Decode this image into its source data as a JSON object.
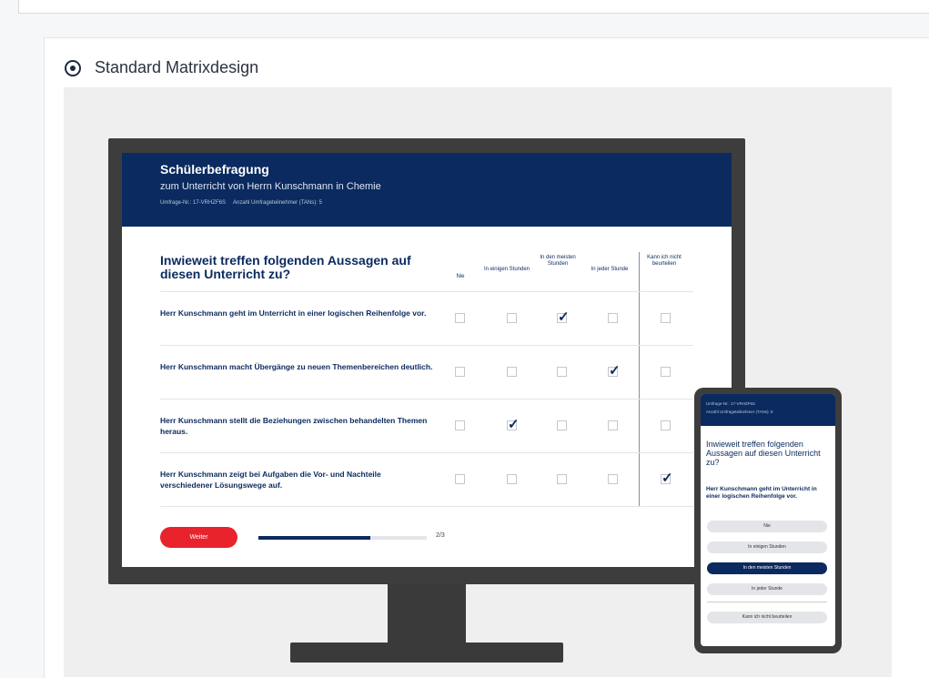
{
  "option": {
    "label": "Standard Matrixdesign",
    "selected": true
  },
  "survey": {
    "title": "Schülerbefragung",
    "subtitle": "zum Unterricht von Herrn Kunschmann in Chemie",
    "meta": [
      "Umfrage-Nr.: 17-VRHZF6S",
      "Anzahl Umfrageteilnehmer (TANs): 5"
    ],
    "question": "Inwieweit treffen folgenden Aussagen auf diesen Unterricht zu?",
    "columns": [
      "Nie",
      "In einigen Stunden",
      "In den meisten Stunden",
      "In jeder Stunde",
      "Kann ich nicht beurteilen"
    ],
    "rows": [
      {
        "text": "Herr Kunschmann geht im Unterricht in einer logischen Reihenfolge vor.",
        "checked_index": 2
      },
      {
        "text": "Herr Kunschmann macht Übergänge zu neuen Themenbereichen deutlich.",
        "checked_index": 3
      },
      {
        "text": "Herr Kunschmann stellt die Beziehungen zwischen behandelten Themen heraus.",
        "checked_index": 1
      },
      {
        "text": "Herr Kunschmann zeigt bei Aufgaben die Vor- und Nachteile verschiedener Lösungswege auf.",
        "checked_index": 4
      }
    ],
    "next_button": "Weiter",
    "progress_fraction": 0.667,
    "page_indicator": "2/3"
  },
  "mobile": {
    "meta": [
      "Umfrage-Nr.: 17-VRHZF6S",
      "Anzahl Umfrageteilnehmer (TANs): 5"
    ],
    "question": "Inwieweit treffen folgenden Aussagen auf diesen Unterricht zu?",
    "statement": "Herr Kunschmann geht im Unterricht in einer logischen Reihenfolge vor.",
    "options": [
      "Nie",
      "In einigen Stunden",
      "In den meisten Stunden",
      "In jeder Stunde",
      "Kann ich nicht beurteilen"
    ],
    "selected_index": 2
  },
  "colors": {
    "brand_navy": "#0b2a5f",
    "accent_red": "#e8232c"
  }
}
